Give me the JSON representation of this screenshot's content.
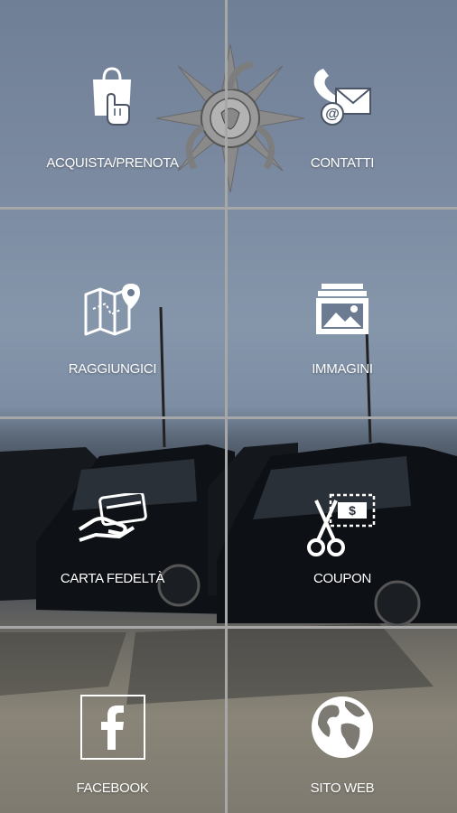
{
  "menu": {
    "tiles": [
      {
        "label": "ACQUISTA/PRENOTA",
        "icon": "shopping-bag-hand-icon"
      },
      {
        "label": "CONTATTI",
        "icon": "phone-mail-icon"
      },
      {
        "label": "RAGGIUNGICI",
        "icon": "map-pin-icon"
      },
      {
        "label": "IMMAGINI",
        "icon": "image-stack-icon"
      },
      {
        "label": "CARTA FEDELTÀ",
        "icon": "loyalty-card-icon"
      },
      {
        "label": "COUPON",
        "icon": "coupon-scissors-icon"
      },
      {
        "label": "FACEBOOK",
        "icon": "facebook-icon"
      },
      {
        "label": "SITO WEB",
        "icon": "globe-icon"
      }
    ]
  },
  "theme": {
    "label_color": "#ffffff",
    "divider_color": "#a7a7a7"
  }
}
